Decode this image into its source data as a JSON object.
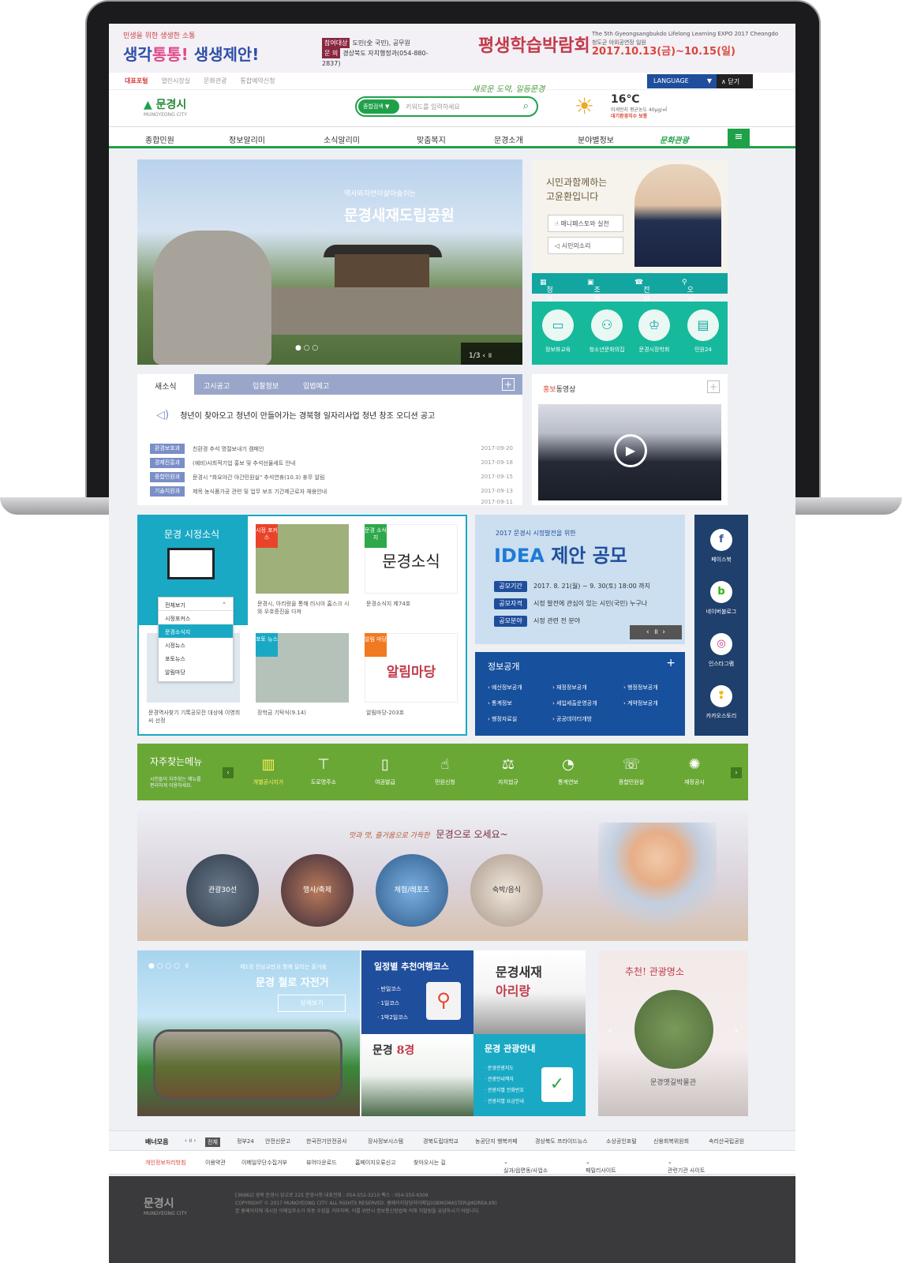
{
  "top_banner": {
    "kicker": "민생을 위한 생생한 소통",
    "title_a": "생각",
    "title_b": "통통!",
    "title_c": "생생제안!",
    "participants_tag": "참여대상",
    "participants": "도민(全 국민), 공무원",
    "contact_tag": "문 의",
    "contact": "경상북도 자치행정과(054-880-2837)",
    "expo_name": "평생학습박람회",
    "expo_en": "The 5th Gyeongsangbukdo Lifelong Learning EXPO 2017 Cheongdo",
    "expo_place": "청도군 야외공연장 일원",
    "expo_date": "2017.10.13(금)~10.15(일)"
  },
  "util": {
    "links": [
      "대표포털",
      "열린시장실",
      "문화관광",
      "통합예약신청"
    ],
    "language": "LANGUAGE",
    "close": "닫기"
  },
  "header": {
    "logo": "문경시",
    "logo_en": "MUNGYEONG CITY",
    "search_select": "종합검색 ▼",
    "search_placeholder": "키워드를 입력하세요",
    "slogan": "새로운 도약, 일등문경",
    "weather_temp": "16℃",
    "weather_detail1": "미세먼지 평균농도 40μg/㎥",
    "weather_detail2": "대기환경지수 보통"
  },
  "gnb": [
    "종합민원",
    "정보알리미",
    "소식알리미",
    "맞춤복지",
    "문경소개",
    "분야별정보",
    "문화관광"
  ],
  "hero": {
    "subtitle": "역사와자연이살아숨쉬는",
    "title": "문경새재도립공원",
    "pager": "1/3"
  },
  "mayor": {
    "quote_line1": "시민과함께하는",
    "quote_line2": "고윤환입니다",
    "btn1": "매니페스토와 실천",
    "btn2": "시민의소리",
    "bar": [
      "청사안내",
      "조직안내",
      "전화번호",
      "오시는길"
    ]
  },
  "quick": [
    "정보화교육",
    "청소년문화의집",
    "문경시장학회",
    "민원24"
  ],
  "news": {
    "tabs": [
      "새소식",
      "고시공고",
      "입찰정보",
      "입법예고"
    ],
    "headline": "청년이 찾아오고 청년이 만들어가는 경북형 일자리사업 청년 창조 오디션 공고",
    "rows": [
      {
        "tag": "환경보호과",
        "text": "친환경 추석 명절보내기 캠페인",
        "date": "2017-09-20"
      },
      {
        "tag": "경제진흥과",
        "text": "(예비)사회적기업 홍보 및 추석선물세트 안내",
        "date": "2017-09-18"
      },
      {
        "tag": "종합민원과",
        "text": "문경시 \"화요야간 야간민원실\" 추석연휴(10.3) 휴무 알림",
        "date": "2017-09-15"
      },
      {
        "tag": "기술지원과",
        "text": "제목 농식품가공 관련 및 업무 보조 기간제근로자 채용안내",
        "date": "2017-09-13"
      }
    ],
    "extra_date": "2017-09-11"
  },
  "promo": {
    "title_a": "홍보",
    "title_b": "동영상"
  },
  "city_news": {
    "title": "문경 시정소식",
    "dropdown": [
      "전체보기",
      "시정포커스",
      "문경소식지",
      "시정뉴스",
      "포토뉴스",
      "알림마당"
    ],
    "cards": [
      {
        "label": "시정 포커스",
        "caption": "문경시, 아리랑을 통해 러시아 홈스크 시와 우호증진을 다져",
        "color": "#e9442a"
      },
      {
        "label": "문경 소식지",
        "caption": "문경소식지 제74호",
        "color": "#2ea84a"
      },
      {
        "label": "",
        "caption": "문경역사찾기 기록공모전 대상에 이영희씨 선정",
        "color": "#1aa9c4"
      },
      {
        "label": "포토 뉴스",
        "caption": "장학금 기탁식(9.14)",
        "color": "#1aa9c4"
      },
      {
        "label": "알림 마당",
        "caption": "알림마당-203호",
        "color": "#f07a22"
      }
    ],
    "news_text": "문경소식",
    "alarm_text": "알림마당"
  },
  "idea": {
    "sub": "2017 문경시 시정발전을 위한",
    "title_a": "IDEA",
    "title_b": "제안 공모",
    "rows": [
      {
        "tag": "공모기간",
        "text": "2017. 8. 21(월) ~ 9. 30(토) 18:00 까지"
      },
      {
        "tag": "공모자격",
        "text": "시정 발전에 관심이 있는 시민(국민) 누구나"
      },
      {
        "tag": "공모분야",
        "text": "시정 관련 전 분야"
      }
    ]
  },
  "info": {
    "title": "정보공개",
    "items": [
      "예산정보공개",
      "재정정보공개",
      "행정정보공개",
      "통계정보",
      "세입세출운영공개",
      "계약정보공개",
      "행정자료실",
      "공공데이터개방"
    ]
  },
  "sns": [
    {
      "name": "페이스북",
      "glyph": "f",
      "color": "#3b5998"
    },
    {
      "name": "네이버블로그",
      "glyph": "b",
      "color": "#2db400"
    },
    {
      "name": "인스타그램",
      "glyph": "◎",
      "color": "#c2307a"
    },
    {
      "name": "카카오스토리",
      "glyph": "❢",
      "color": "#f3b800"
    }
  ],
  "favs": {
    "title": "자주찾는메뉴",
    "desc1": "시민들이 자주찾는 메뉴를",
    "desc2": "편리하게 이용하세요.",
    "items": [
      "개별공시지가",
      "도로명주소",
      "여권발급",
      "민원신청",
      "자치법규",
      "통계연보",
      "종합민원실",
      "재정공시"
    ]
  },
  "tour": {
    "sub": "맛과 멋, 즐거움으로 가득한",
    "title": "문경으로 오세요~",
    "circles": [
      "관광30선",
      "행사/축제",
      "체험/레포츠",
      "숙박/음식"
    ]
  },
  "rail": {
    "sub": "제1경 진남교반과 함께 달리는 즐거움",
    "title": "문경 철로 자전거",
    "btn": "상세보기"
  },
  "course": {
    "title": "일정별 추천여행코스",
    "items": [
      "· 반일코스",
      "· 1일코스",
      "· 1박2일코스"
    ]
  },
  "arirang": {
    "a": "문경새재",
    "b": "아리랑"
  },
  "eight": {
    "a": "문경",
    "b": "8경"
  },
  "guide": {
    "title": "문경 관광안내",
    "items": [
      "· 문경관광지도",
      "· 관광안내책자",
      "· 관광지별 전화번호",
      "· 관광지별 요금안내"
    ]
  },
  "spot": {
    "title": "추천! 관광명소",
    "name": "문경옛길박물관"
  },
  "banners": {
    "label": "배너모음",
    "all": "전체",
    "items": [
      "정부24",
      "안전신문고",
      "한국전기안전공사",
      "장사정보시스템",
      "경북도립대학교",
      "농공단지 행복카페",
      "경상북도 프라이드뉴스",
      "소상공인포털",
      "신용회복위원회",
      "속리산국립공원"
    ]
  },
  "footer": {
    "links": [
      "개인정보처리방침",
      "이용약관",
      "이메일무단수집거부",
      "뷰어다운로드",
      "홈페이지오류신고",
      "찾아오시는 길"
    ],
    "selects": [
      "실과/읍면동/사업소",
      "패밀리사이트",
      "관련기관 사이트"
    ],
    "address": "[36982] 경북 문경시 당교로 225 문경시청   대표전화 : 054-552-3210   팩스 : 054-550-6309",
    "copyright": "COPYRIGHT © 2017 MUNGYEONG CITY. ALL RIGHTS RESERVED.  홈페이지담당자이메일(GBMGMASTER@KOREA.KR)",
    "notice": "본 홈페이지에 게시된 이메일주소가 자동 수집을 거부하며, 이를 위반시 정보통신망법에 의해 처벌됨을 유념하시기 바랍니다."
  }
}
